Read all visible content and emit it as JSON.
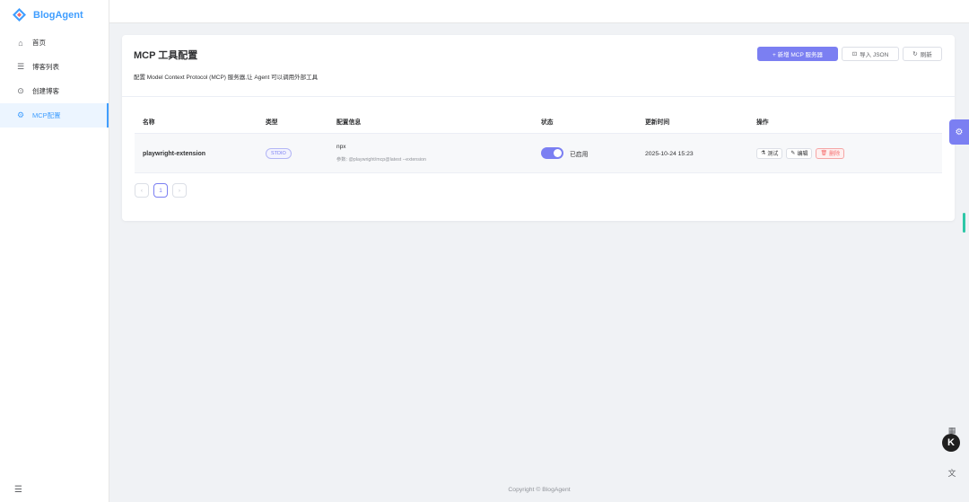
{
  "app": {
    "name": "BlogAgent",
    "brand_color": "#409eff",
    "accent_color": "#7b7ff2"
  },
  "sidebar": {
    "items": [
      {
        "label": "首页",
        "icon": "home-icon"
      },
      {
        "label": "博客列表",
        "icon": "list-icon"
      },
      {
        "label": "创建博客",
        "icon": "plus-circle-icon"
      },
      {
        "label": "MCP配置",
        "icon": "gear-icon",
        "active": true
      }
    ]
  },
  "page": {
    "title": "MCP 工具配置",
    "description": "配置 Model Context Protocol (MCP) 服务器,让 Agent 可以调用外部工具",
    "buttons": {
      "add": "+ 新增 MCP 服务器",
      "import": "导入 JSON",
      "refresh": "刷新"
    }
  },
  "table": {
    "columns": [
      "名称",
      "类型",
      "配置信息",
      "状态",
      "更新时间",
      "操作"
    ],
    "rows": [
      {
        "name": "playwright-extension",
        "type": "STDIO",
        "config_cmd": "npx",
        "config_args": "参数: @playwright/mcp@latest --extension",
        "status": "已启用",
        "enabled": true,
        "updated": "2025-10-24 15:23",
        "actions": {
          "test": "测试",
          "edit": "编辑",
          "delete": "删除"
        }
      }
    ]
  },
  "pagination": {
    "current": "1",
    "prev": "‹",
    "next": "›"
  },
  "footer": {
    "text": "Copyright © BlogAgent"
  }
}
